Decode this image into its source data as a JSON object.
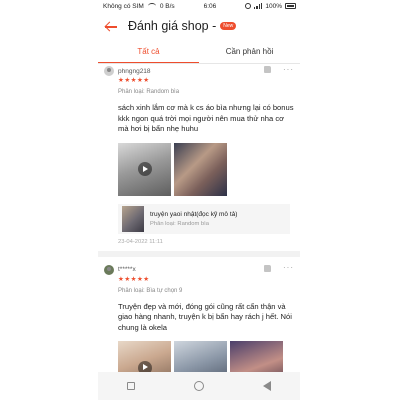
{
  "status_bar": {
    "carrier": "Không có SIM",
    "speed": "0 B/s",
    "time": "6:06",
    "battery": "100%"
  },
  "header": {
    "title": "Đánh giá shop -",
    "badge": "New"
  },
  "tabs": [
    {
      "label": "Tất cả",
      "active": true
    },
    {
      "label": "Cần phản hồi",
      "active": false
    }
  ],
  "reviews": [
    {
      "username": "phngng218",
      "stars": "★★★★★",
      "variant": "Phân loại: Random bìa",
      "text": "sách xinh lắm cơ mà k cs áo bìa nhưng lại có bonus kkk ngon quá trời mọi người nên mua thử nha cơ mà hơi bị bẩn nhẹ huhu",
      "product_name": "truyện yaoi nhật(đọc kỹ mô tả)",
      "product_variant": "Phân loại: Random bìa",
      "date": "23-04-2022 11:11"
    },
    {
      "username": "t*****x",
      "stars": "★★★★★",
      "variant": "Phân loại: Bìa tự chọn 9",
      "text": "Truyện đẹp và mới, đóng gói cũng rất cẩn thận và giao hàng nhanh, truyện k bị bẩn hay rách j hết. Nói chung là okela"
    }
  ],
  "colors": {
    "accent": "#ee4d2d"
  }
}
